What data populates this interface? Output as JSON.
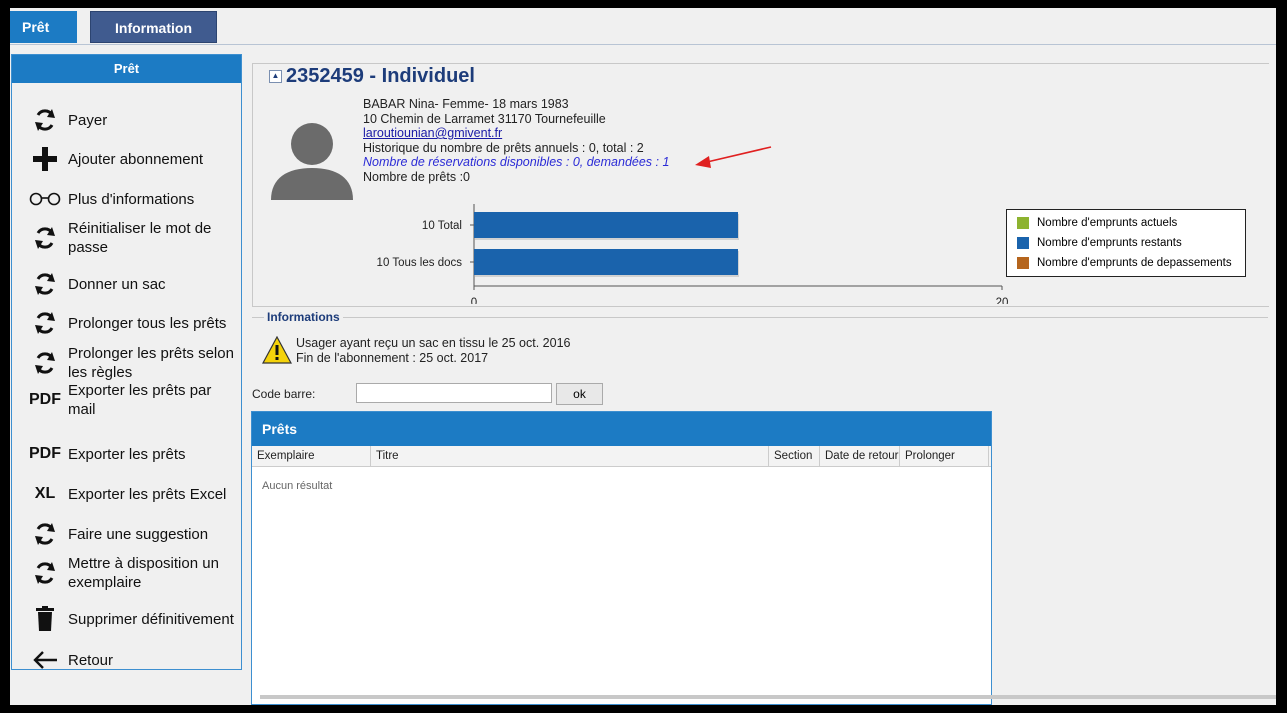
{
  "tabs": {
    "pret": "Prêt",
    "information": "Information"
  },
  "sidebar": {
    "header": "Prêt",
    "items": [
      {
        "label": "Payer",
        "icon": "refresh-icon"
      },
      {
        "label": "Ajouter abonnement",
        "icon": "plus-icon"
      },
      {
        "label": "Plus d'informations",
        "icon": "glasses-icon"
      },
      {
        "label": "Réinitialiser le mot de passe",
        "icon": "refresh-icon"
      },
      {
        "label": "Donner un sac",
        "icon": "refresh-icon"
      },
      {
        "label": "Prolonger tous les prêts",
        "icon": "refresh-icon"
      },
      {
        "label": "Prolonger les prêts selon les règles",
        "icon": "refresh-icon"
      },
      {
        "label": "Exporter les prêts par mail",
        "icon": "pdf-icon",
        "icon_text": "PDF"
      },
      {
        "label": "Exporter les prêts",
        "icon": "pdf-icon",
        "icon_text": "PDF"
      },
      {
        "label": "Exporter les prêts Excel",
        "icon": "xl-icon",
        "icon_text": "XL"
      },
      {
        "label": "Faire une suggestion",
        "icon": "refresh-icon"
      },
      {
        "label": "Mettre à disposition un exemplaire",
        "icon": "refresh-icon"
      },
      {
        "label": "Supprimer définitivement",
        "icon": "trash-icon"
      },
      {
        "label": "Retour",
        "icon": "arrow-left-icon"
      }
    ]
  },
  "user": {
    "title": "2352459 - Individuel",
    "identity": "BABAR Nina- Femme- 18 mars 1983",
    "address": "10 Chemin de Larramet 31170 Tournefeuille",
    "email": "laroutiounian@gmivent.fr",
    "history": "Historique du nombre de prêts annuels : 0, total : 2",
    "reservations": "Nombre de réservations disponibles : 0, demandées : 1",
    "loans": "Nombre de prêts :0"
  },
  "chart_data": {
    "type": "bar",
    "orientation": "horizontal",
    "categories": [
      "10 Total",
      "10 Tous les docs"
    ],
    "series": [
      {
        "name": "Nombre d'emprunts actuels",
        "color": "#8db330",
        "values": [
          0,
          0
        ]
      },
      {
        "name": "Nombre d'emprunts restants",
        "color": "#1a63ac",
        "values": [
          10,
          10
        ]
      },
      {
        "name": "Nombre d'emprunts de depassements",
        "color": "#b5651d",
        "values": [
          0,
          0
        ]
      }
    ],
    "xlim": [
      0,
      20
    ],
    "xticks": [
      "0",
      "20"
    ],
    "legend_position": "right"
  },
  "informations": {
    "legend": "Informations",
    "line1": "Usager ayant reçu un sac en tissu le 25 oct. 2016",
    "line2": "Fin de l'abonnement : 25 oct. 2017"
  },
  "barcode": {
    "label": "Code barre:",
    "value": "",
    "button": "ok"
  },
  "loans_panel": {
    "title": "Prêts",
    "columns": [
      "Exemplaire",
      "Titre",
      "Section",
      "Date de retour",
      "Prolonger"
    ],
    "empty_text": "Aucun résultat"
  }
}
